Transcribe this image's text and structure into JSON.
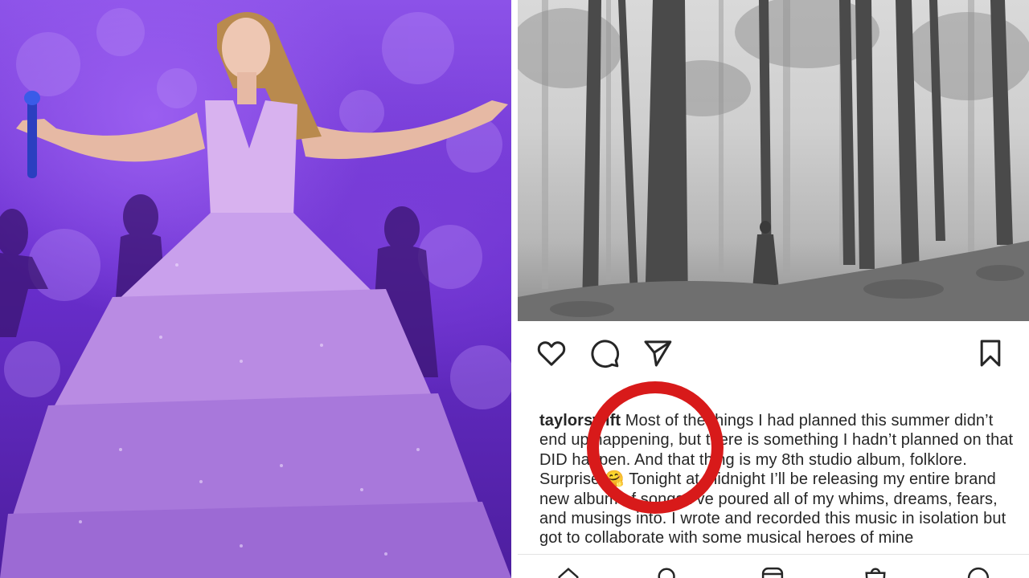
{
  "caption": {
    "username": "taylorswift",
    "text": " Most of the things I had planned this summer didn’t end up happening, but there is something I hadn’t planned on that DID happen. And that thing is my 8th studio album, folklore. Surprise 🤗 Tonight at midnight I’ll be releasing my entire brand new album of songs I’ve poured all of my whims, dreams, fears, and musings into. I wrote and recorded this music in isolation but got to collaborate with some musical heroes of mine"
  },
  "icons": {
    "like": "heart-icon",
    "comment": "comment-icon",
    "share": "paper-plane-icon",
    "save": "bookmark-icon",
    "nav": [
      "home-icon",
      "search-icon",
      "reels-icon",
      "shop-icon",
      "profile-icon"
    ]
  },
  "colors": {
    "highlight_circle": "#d81a1a",
    "concert_purple": "#7a3ed8",
    "text": "#262626"
  }
}
